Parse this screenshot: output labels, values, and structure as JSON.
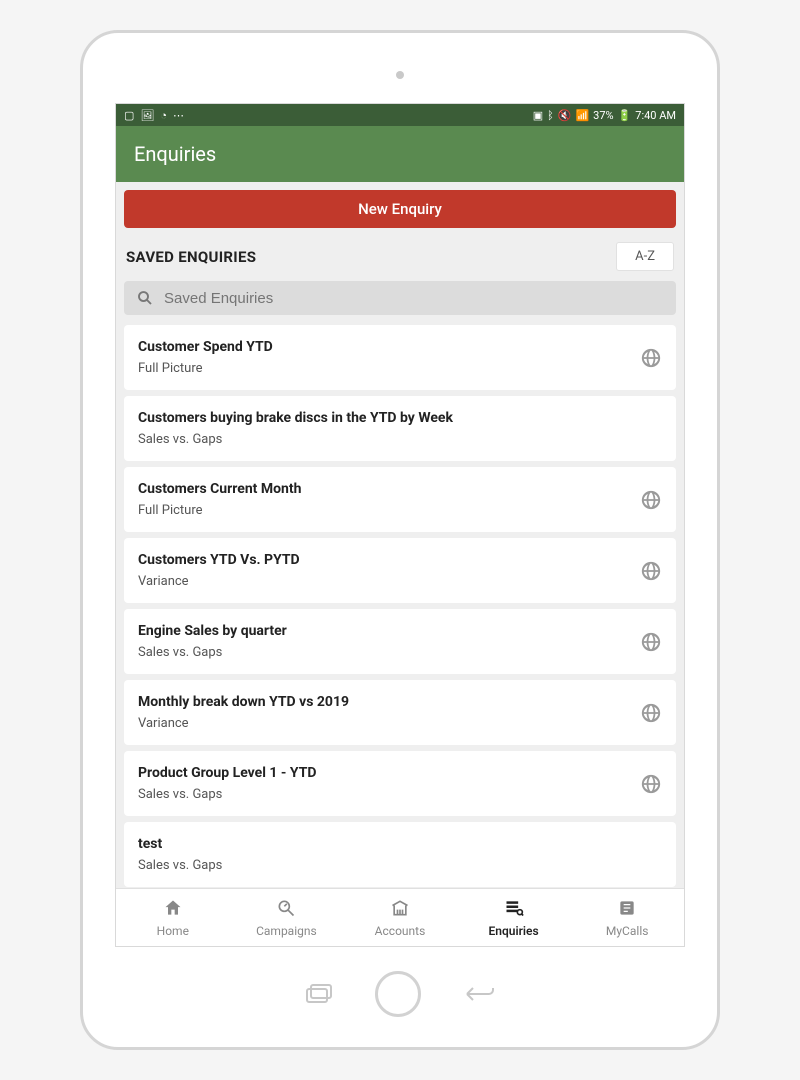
{
  "status": {
    "battery_text": "37%",
    "time": "7:40 AM"
  },
  "header": {
    "title": "Enquiries"
  },
  "actions": {
    "new_enquiry": "New Enquiry",
    "sort_label": "A-Z"
  },
  "section": {
    "title": "SAVED ENQUIRIES"
  },
  "search": {
    "placeholder": "Saved Enquiries"
  },
  "items": [
    {
      "title": "Customer Spend YTD",
      "subtitle": "Full Picture",
      "has_globe": true
    },
    {
      "title": "Customers buying brake discs in the YTD by Week",
      "subtitle": "Sales vs. Gaps",
      "has_globe": false
    },
    {
      "title": "Customers Current Month",
      "subtitle": "Full Picture",
      "has_globe": true
    },
    {
      "title": "Customers YTD Vs. PYTD",
      "subtitle": "Variance",
      "has_globe": true
    },
    {
      "title": "Engine Sales by quarter",
      "subtitle": "Sales vs. Gaps",
      "has_globe": true
    },
    {
      "title": "Monthly break down YTD vs 2019",
      "subtitle": "Variance",
      "has_globe": true
    },
    {
      "title": "Product Group Level 1 - YTD",
      "subtitle": "Sales vs. Gaps",
      "has_globe": true
    },
    {
      "title": "test",
      "subtitle": "Sales vs. Gaps",
      "has_globe": false
    }
  ],
  "nav": {
    "items": [
      {
        "label": "Home",
        "icon": "home",
        "active": false
      },
      {
        "label": "Campaigns",
        "icon": "campaigns",
        "active": false
      },
      {
        "label": "Accounts",
        "icon": "accounts",
        "active": false
      },
      {
        "label": "Enquiries",
        "icon": "enquiries",
        "active": true
      },
      {
        "label": "MyCalls",
        "icon": "mycalls",
        "active": false
      }
    ]
  }
}
